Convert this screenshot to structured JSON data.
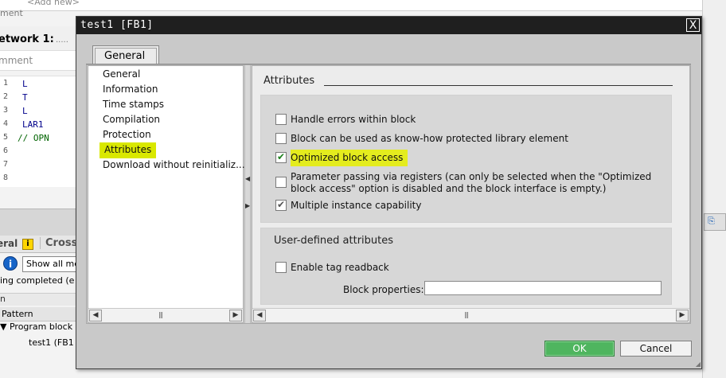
{
  "background": {
    "add_new": "<Add new>",
    "ment": "ment",
    "network_title": "etwork 1:",
    "network_dots": ".....",
    "comment_placeholder": "mment",
    "code_lines": [
      {
        "num": "1",
        "text": "L"
      },
      {
        "num": "2",
        "text": "T"
      },
      {
        "num": "3",
        "text": "L"
      },
      {
        "num": "4",
        "text": "LAR1"
      },
      {
        "num": "5",
        "text": "//    OPN"
      },
      {
        "num": "6",
        "text": ""
      },
      {
        "num": "7",
        "text": ""
      },
      {
        "num": "8",
        "text": ""
      }
    ],
    "tab_general": "eral",
    "tab_cross": "Cross",
    "show_all": "Show all me",
    "status": "ing completed (e",
    "strip2": "n",
    "pattern": "Pattern",
    "tree_program": "Program block",
    "tree_test1": "test1 (FB1"
  },
  "dialog": {
    "title": "test1 [FB1]",
    "close": "X",
    "tab_label": "General",
    "nav_items": [
      "General",
      "Information",
      "Time stamps",
      "Compilation",
      "Protection",
      "Attributes",
      "Download without reinitializ..."
    ],
    "attributes_title": "Attributes",
    "attributes": [
      {
        "label": "Handle errors within block",
        "checked": false
      },
      {
        "label": "Block can be used as know-how protected library element",
        "checked": false
      },
      {
        "label": "Optimized block access",
        "checked": true
      },
      {
        "label": "Parameter passing via registers (can only be selected when the \"Optimized block access\" option is disabled and the block interface is empty.)",
        "checked": false
      },
      {
        "label": "Multiple instance capability",
        "checked": true
      }
    ],
    "uda_title": "User-defined attributes",
    "enable_tag_readback": "Enable tag readback",
    "block_properties_label": "Block properties:",
    "ok_label": "OK",
    "cancel_label": "Cancel"
  },
  "colors": {
    "highlight": "#e4ec1e",
    "ok_button": "#4fb55f",
    "titlebar": "#1f1f1f"
  }
}
